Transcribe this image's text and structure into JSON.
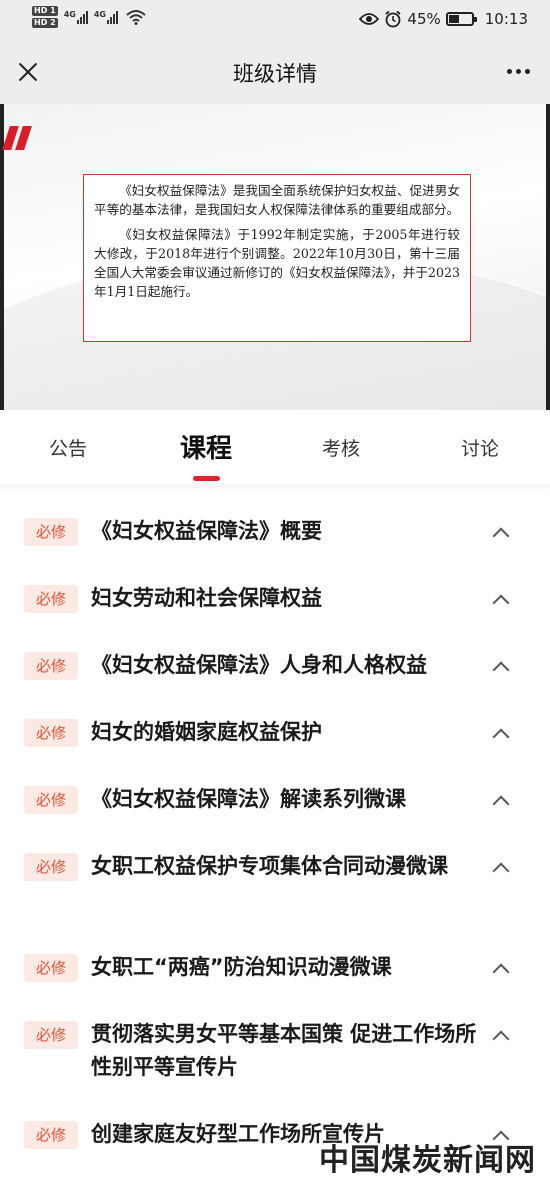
{
  "status_bar": {
    "sim1": "HD 1",
    "sim2": "HD 2",
    "network1": "4G",
    "network2": "4G",
    "battery_percent": "45%",
    "battery_level": 0.45,
    "time": "10:13",
    "icons": [
      "eye-icon",
      "alarm-icon",
      "wifi-icon",
      "battery-icon"
    ]
  },
  "header": {
    "title": "班级详情",
    "close_icon": "close-icon",
    "more_icon": "more-icon"
  },
  "banner": {
    "paragraph1": "《妇女权益保障法》是我国全面系统保护妇女权益、促进男女平等的基本法律，是我国妇女人权保障法律体系的重要组成部分。",
    "paragraph2": "《妇女权益保障法》于1992年制定实施，于2005年进行较大修改，于2018年进行个别调整。2022年10月30日，第十三届全国人大常委会审议通过新修订的《妇女权益保障法》，并于2023年1月1日起施行。"
  },
  "tabs": [
    {
      "label": "公告",
      "active": false
    },
    {
      "label": "课程",
      "active": true
    },
    {
      "label": "考核",
      "active": false
    },
    {
      "label": "讨论",
      "active": false
    }
  ],
  "courses": [
    {
      "badge": "必修",
      "title": "《妇女权益保障法》概要"
    },
    {
      "badge": "必修",
      "title": "妇女劳动和社会保障权益"
    },
    {
      "badge": "必修",
      "title": "《妇女权益保障法》人身和人格权益"
    },
    {
      "badge": "必修",
      "title": "妇女的婚姻家庭权益保护"
    },
    {
      "badge": "必修",
      "title": "《妇女权益保障法》解读系列微课"
    },
    {
      "badge": "必修",
      "title": "女职工权益保护专项集体合同动漫微课"
    },
    {
      "badge": "必修",
      "title": "女职工“两癌”防治知识动漫微课"
    },
    {
      "badge": "必修",
      "title": "贯彻落实男女平等基本国策 促进工作场所性别平等宣传片"
    },
    {
      "badge": "必修",
      "title": "创建家庭友好型工作场所宣传片"
    }
  ],
  "watermark": "中国煤炭新闻网",
  "colors": {
    "accent": "#e2242a",
    "badge_bg": "#fde9e3",
    "badge_text": "#e55336",
    "header_bg": "#ededed"
  }
}
